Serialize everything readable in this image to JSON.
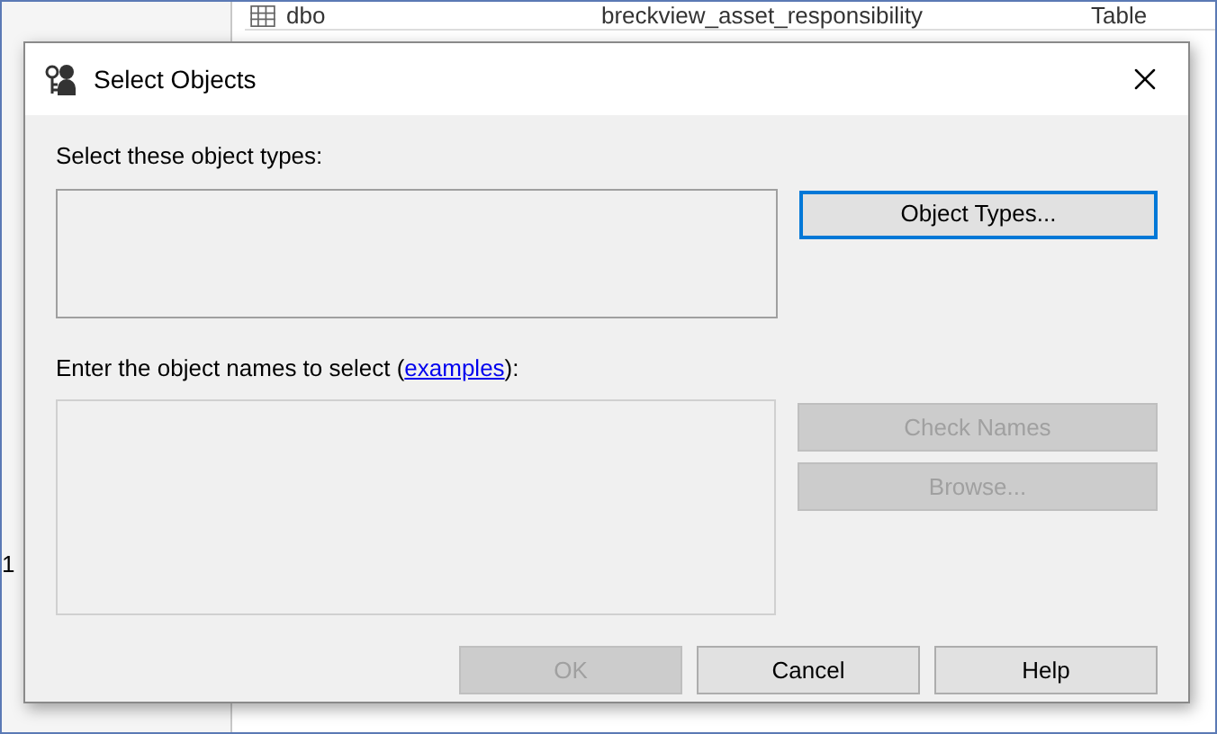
{
  "background": {
    "rows": [
      {
        "schema": "dbo",
        "name": "breckview_asset_responsibility",
        "type": "Table"
      }
    ],
    "side_text": "1"
  },
  "dialog": {
    "title": "Select Objects",
    "types_label": "Select these object types:",
    "types_button": {
      "label": "Object Types...",
      "disabled": false,
      "focused": true
    },
    "names_label": {
      "before": "Enter the object names to select (",
      "link": "examples",
      "after": "):"
    },
    "side_buttons": [
      {
        "label": "Check Names",
        "disabled": true
      },
      {
        "label": "Browse...",
        "disabled": true
      }
    ],
    "footer_buttons": [
      {
        "label": "OK",
        "disabled": true
      },
      {
        "label": "Cancel",
        "disabled": false
      },
      {
        "label": "Help",
        "disabled": false
      }
    ]
  }
}
